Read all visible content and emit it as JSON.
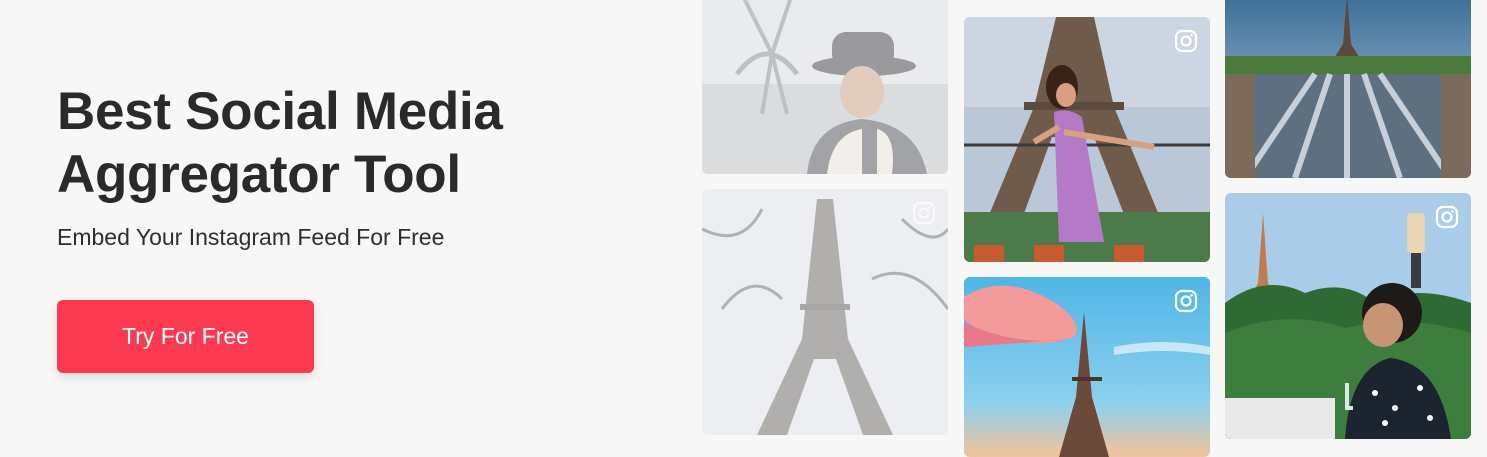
{
  "hero": {
    "title_line1": "Best Social Media",
    "title_line2": "Aggregator Tool",
    "subtitle": "Embed Your Instagram Feed For Free",
    "cta_label": "Try For Free"
  },
  "colors": {
    "background": "#f7f7f7",
    "cta": "#fb3a52",
    "heading": "#2a2a2a"
  },
  "feed": {
    "icon": "instagram-icon",
    "tiles": [
      {
        "name": "feed-photo-man-hat",
        "faded": true,
        "badge": false
      },
      {
        "name": "feed-photo-eiffel-trees",
        "faded": true,
        "badge": true
      },
      {
        "name": "feed-photo-woman-purple-dress",
        "faded": false,
        "badge": true
      },
      {
        "name": "feed-photo-eiffel-sunset-sky",
        "faded": false,
        "badge": true
      },
      {
        "name": "feed-photo-trocadero-fountains",
        "faded": false,
        "badge": false
      },
      {
        "name": "feed-photo-man-greenery",
        "faded": false,
        "badge": true
      }
    ]
  }
}
